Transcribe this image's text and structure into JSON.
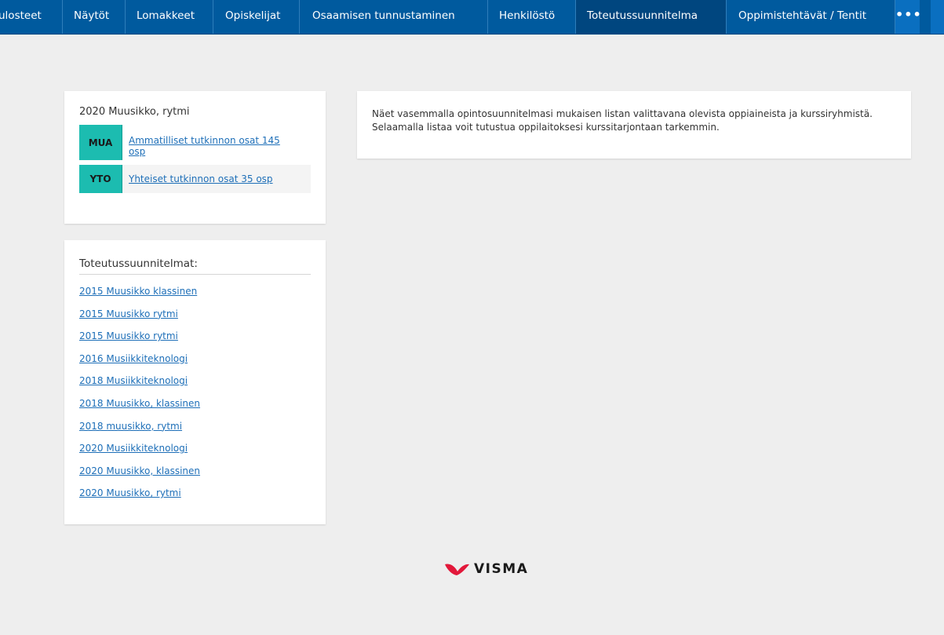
{
  "nav": {
    "items": [
      {
        "label": "ulosteet",
        "active": false
      },
      {
        "label": "Näytöt",
        "active": false
      },
      {
        "label": "Lomakkeet",
        "active": false
      },
      {
        "label": "Opiskelijat",
        "active": false
      },
      {
        "label": "Osaamisen tunnustaminen",
        "active": false
      },
      {
        "label": "Henkilöstö",
        "active": false
      },
      {
        "label": "Toteutussuunnitelma",
        "active": true
      },
      {
        "label": "Oppimistehtävät / Tentit",
        "active": false
      }
    ],
    "more_label": "•••",
    "colors": {
      "bar": "#005a9e",
      "active": "#00467f",
      "more": "#0a6fc0"
    }
  },
  "plan": {
    "title": "2020 Muusikko, rytmi",
    "groups": [
      {
        "code": "MUA",
        "label": "Ammatilliset tutkinnon osat 145 osp"
      },
      {
        "code": "YTO",
        "label": "Yhteiset tutkinnon osat 35 osp"
      }
    ],
    "code_color": "#1cbcb0"
  },
  "implementation_plans": {
    "header": "Toteutussuunnitelmat:",
    "items": [
      "2015 Muusikko klassinen",
      "2015 Muusikko rytmi",
      "2015 Muusikko rytmi",
      "2016 Musiikkiteknologi",
      "2018 Musiikkiteknologi",
      "2018 Muusikko, klassinen",
      "2018 muusikko, rytmi",
      "2020 Musiikkiteknologi",
      "2020 Muusikko, klassinen",
      "2020 Muusikko, rytmi"
    ]
  },
  "info": {
    "text": "Näet vasemmalla opintosuunnitelmasi mukaisen listan valittavana olevista oppiaineista ja kurssiryhmistä. Selaamalla listaa voit tutustua oppilaitoksesi kurssitarjontaan tarkemmin."
  },
  "footer": {
    "logo_text": "VISMA",
    "logo_color": "#e2183a"
  }
}
